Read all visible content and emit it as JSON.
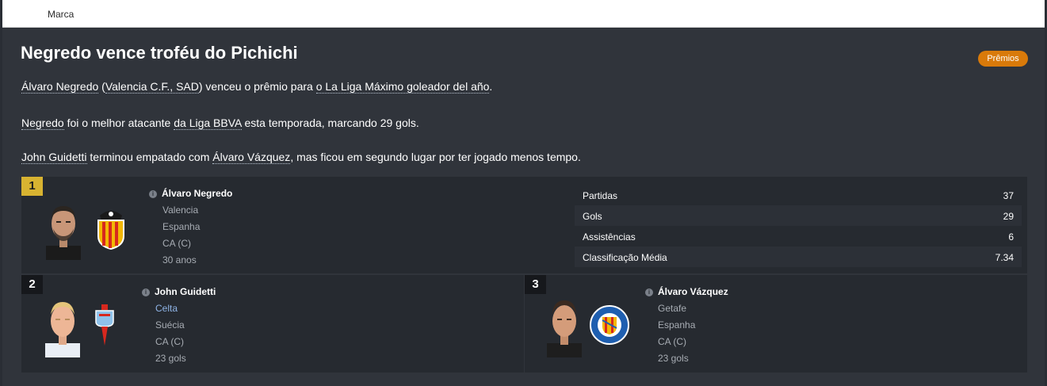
{
  "topbar": {
    "crumb": "Marca"
  },
  "news": {
    "title": "Negredo vence troféu do Pichichi",
    "badge": "Prêmios",
    "line1": {
      "player": "Álvaro Negredo",
      "p1": " (",
      "club": "Valencia C.F., SAD",
      "p2": ") venceu o prêmio para ",
      "award": "o La Liga Máximo goleador del año",
      "p3": "."
    },
    "line2": {
      "player": "Negredo",
      "p1": " foi o melhor atacante ",
      "league": "da Liga BBVA",
      "p2": " esta temporada, marcando 29 gols."
    },
    "line3": {
      "player1": "John Guidetti",
      "p1": " terminou empatado com ",
      "player2": "Álvaro Vázquez",
      "p2": ", mas ficou em segundo lugar por ter jogado menos tempo."
    }
  },
  "winner": {
    "rank": "1",
    "name": "Álvaro Negredo",
    "club": "Valencia",
    "nation": "Espanha",
    "position": "CA (C)",
    "age": "30 anos",
    "stats": [
      {
        "label": "Partidas",
        "value": "37"
      },
      {
        "label": "Gols",
        "value": "29"
      },
      {
        "label": "Assistências",
        "value": "6"
      },
      {
        "label": "Classificação Média",
        "value": "7.34"
      }
    ]
  },
  "second": {
    "rank": "2",
    "name": "John Guidetti",
    "club": "Celta",
    "nation": "Suécia",
    "position": "CA (C)",
    "goals": "23 gols"
  },
  "third": {
    "rank": "3",
    "name": "Álvaro Vázquez",
    "club": "Getafe",
    "nation": "Espanha",
    "position": "CA (C)",
    "goals": "23 gols"
  },
  "colors": {
    "background": "#30343b",
    "card": "#262a30",
    "badge": "#d97a0a",
    "gold_rank": "#d8b331",
    "link": "#8fb4e6"
  }
}
